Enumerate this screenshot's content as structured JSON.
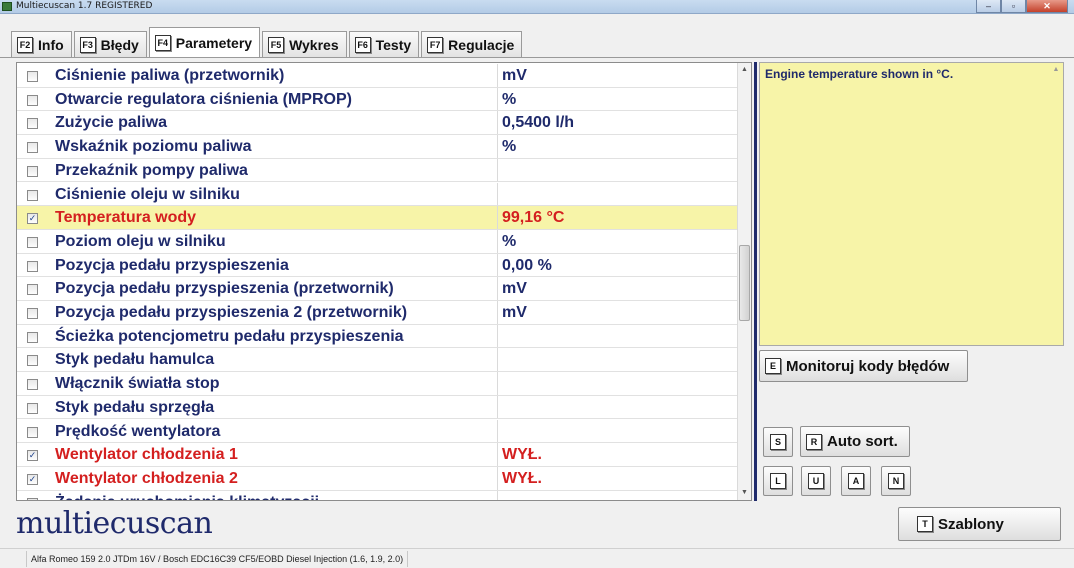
{
  "window": {
    "title": "Multiecuscan 1.7 REGISTERED",
    "min_label": "–",
    "max_label": "▫",
    "close_label": "✕"
  },
  "tabs": [
    {
      "key": "F2",
      "label": "Info"
    },
    {
      "key": "F3",
      "label": "Błędy"
    },
    {
      "key": "F4",
      "label": "Parametery",
      "active": true
    },
    {
      "key": "F5",
      "label": "Wykres"
    },
    {
      "key": "F6",
      "label": "Testy"
    },
    {
      "key": "F7",
      "label": "Regulacje"
    }
  ],
  "parameters": [
    {
      "name": "Ciśnienie paliwa (przetwornik)",
      "value": " mV",
      "checked": false
    },
    {
      "name": "Otwarcie regulatora ciśnienia (MPROP)",
      "value": " %",
      "checked": false
    },
    {
      "name": "Zużycie paliwa",
      "value": "0,5400 l/h",
      "checked": false
    },
    {
      "name": "Wskaźnik poziomu paliwa",
      "value": " %",
      "checked": false
    },
    {
      "name": "Przekaźnik pompy paliwa",
      "value": "",
      "checked": false
    },
    {
      "name": "Ciśnienie oleju w silniku",
      "value": "",
      "checked": false
    },
    {
      "name": "Temperatura wody",
      "value": "99,16 °C",
      "checked": true,
      "selected": true
    },
    {
      "name": "Poziom oleju w silniku",
      "value": " %",
      "checked": false
    },
    {
      "name": "Pozycja pedału przyspieszenia",
      "value": "0,00 %",
      "checked": false
    },
    {
      "name": "Pozycja pedału przyspieszenia (przetwornik)",
      "value": " mV",
      "checked": false
    },
    {
      "name": "Pozycja pedału przyspieszenia 2 (przetwornik)",
      "value": " mV",
      "checked": false
    },
    {
      "name": "Ścieżka potencjometru pedału przyspieszenia",
      "value": "",
      "checked": false
    },
    {
      "name": "Styk pedału hamulca",
      "value": "",
      "checked": false
    },
    {
      "name": "Włącznik światła stop",
      "value": "",
      "checked": false
    },
    {
      "name": "Styk pedału sprzęgła",
      "value": "",
      "checked": false
    },
    {
      "name": "Prędkość wentylatora",
      "value": "",
      "checked": false
    },
    {
      "name": "Wentylator chłodzenia 1",
      "value": "WYŁ.",
      "checked": true
    },
    {
      "name": "Wentylator chłodzenia 2",
      "value": "WYŁ.",
      "checked": true
    },
    {
      "name": "Żądanie uruchomienia klimatyzacji",
      "value": "",
      "checked": false
    }
  ],
  "description": {
    "text": "Engine temperature shown in °C."
  },
  "buttons": {
    "monitor": {
      "key": "E",
      "label": "Monitoruj kody błędów"
    },
    "s": {
      "key": "S"
    },
    "auto_sort": {
      "key": "R",
      "label": "Auto sort."
    },
    "l": {
      "key": "L"
    },
    "u": {
      "key": "U"
    },
    "a": {
      "key": "A"
    },
    "n": {
      "key": "N"
    },
    "templates": {
      "key": "T",
      "label": "Szablony"
    }
  },
  "logo": {
    "text": "multiecuscan"
  },
  "status": {
    "vehicle": "Alfa Romeo 159 2.0 JTDm 16V / Bosch EDC16C39 CF5/EOBD Diesel Injection (1.6, 1.9, 2.0)"
  },
  "colors": {
    "accent": "#1f2a6b",
    "highlight": "#f7f4a8",
    "alert": "#d41f1f"
  }
}
